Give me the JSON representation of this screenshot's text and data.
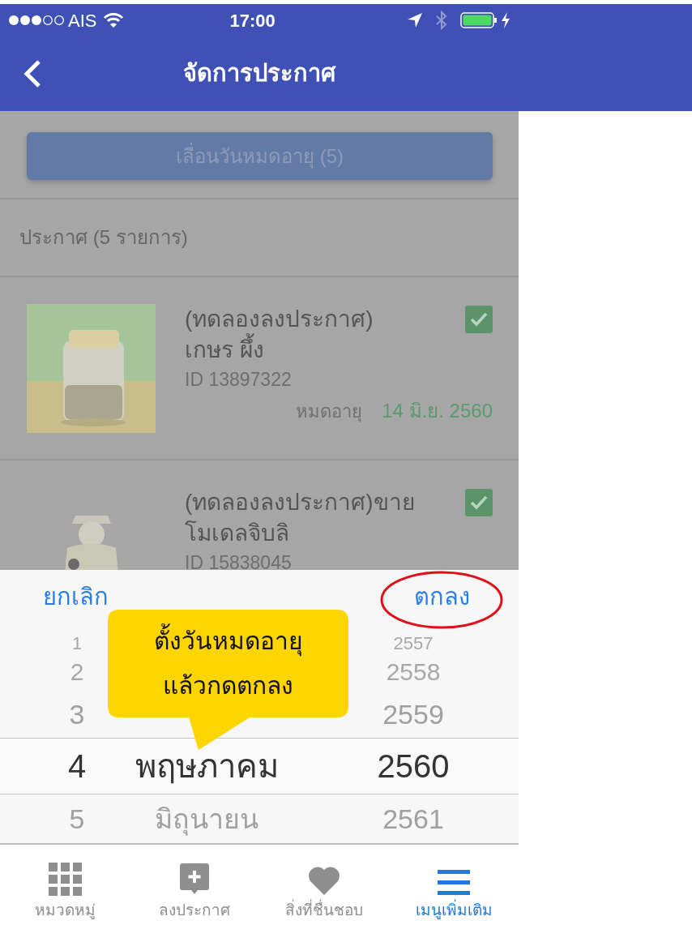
{
  "status_bar": {
    "carrier": "AIS",
    "time": "17:00"
  },
  "nav": {
    "title": "จัดการประกาศ"
  },
  "extend_button": {
    "label": "เลื่อนวันหมดอายุ (5)"
  },
  "section_heading": "ประกาศ (5 รายการ)",
  "listings": [
    {
      "title": "(ทดลองลงประกาศ) เกษร ผึ้ง",
      "id": "ID 13897322",
      "expiry_label": "หมดอายุ",
      "expiry": "14 มิ.ย. 2560",
      "checked": true
    },
    {
      "title": "(ทดลองลงประกาศ)ขาย โมเดลจิบลิ",
      "id": "ID 15838045",
      "checked": true
    }
  ],
  "picker": {
    "cancel": "ยกเลิก",
    "confirm": "ตกลง",
    "rows": [
      {
        "day": "1",
        "year": "2557",
        "selected": false
      },
      {
        "day": "2",
        "year": "2558",
        "selected": false
      },
      {
        "day": "3",
        "year": "2559",
        "selected": false
      },
      {
        "day": "4",
        "month": "พฤษภาคม",
        "year": "2560",
        "selected": true
      },
      {
        "day": "5",
        "month": "มิถุนายน",
        "year": "2561",
        "selected": false
      }
    ]
  },
  "callout": {
    "lines": [
      "ตั้งวันหมดอายุ",
      "แล้วกดตกลง"
    ]
  },
  "tabs": [
    {
      "label": "หมวดหมู่",
      "selected": false
    },
    {
      "label": "ลงประกาศ",
      "selected": false
    },
    {
      "label": "สิ่งที่ชื่นชอบ",
      "selected": false
    },
    {
      "label": "เมนูเพิ่มเติม",
      "selected": true
    }
  ]
}
